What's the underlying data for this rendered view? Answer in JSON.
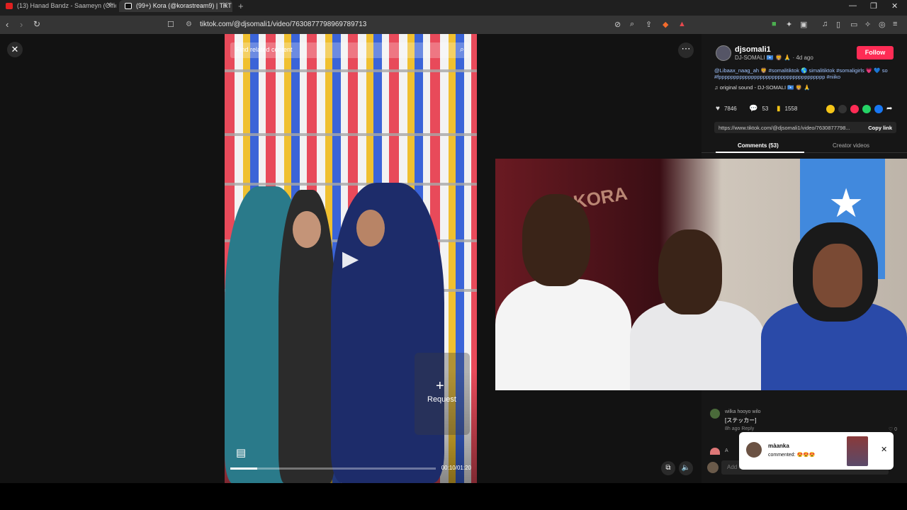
{
  "browser": {
    "tabs": [
      {
        "title": "(13) Hanad Bandz - Saameyn (Officia",
        "color": "#e02020"
      },
      {
        "title": "(99+) Kora (@korastream9) | TikT",
        "color": "#ffffff"
      }
    ],
    "url": "tiktok.com/@djsomali1/video/7630877798969789713"
  },
  "video": {
    "search_placeholder": "Find related content",
    "request_label": "Request",
    "time": "00:10/01:20",
    "progress": 0.13
  },
  "author": {
    "username": "djsomali1",
    "subline": "DJ-SOMALI 🇸🇴 🦁 🙏 · 4d ago",
    "follow_label": "Follow",
    "description": "@Libaax_naag_ah 🦁 #somalitiktok 🌎 simalitiktok #somaligirls 💗 💙 so #fpppppppppppppppppppppppppppppppppppp #niiko",
    "sound": "♫  original sound - DJ-SOMALI 🇸🇴 🦁 🙏"
  },
  "stats": {
    "likes": "7846",
    "comments": "53",
    "saves": "1558"
  },
  "share": {
    "link": "https://www.tiktok.com/@djsomali1/video/7630877798...",
    "copy_label": "Copy link"
  },
  "tabs": {
    "comments": "Comments (53)",
    "creator": "Creator videos"
  },
  "comment": {
    "user": "wilka hooyo wilo",
    "text": "[ステッカー]",
    "meta": "8h ago  Reply",
    "likes": "0",
    "user2": "A"
  },
  "add_comment": {
    "placeholder": "Add comment..."
  },
  "notification": {
    "user": "màanka",
    "text": "commented: 😍😍😍"
  },
  "colors": {
    "accent": "#fe2c55",
    "tag": "#9fc3ff"
  }
}
